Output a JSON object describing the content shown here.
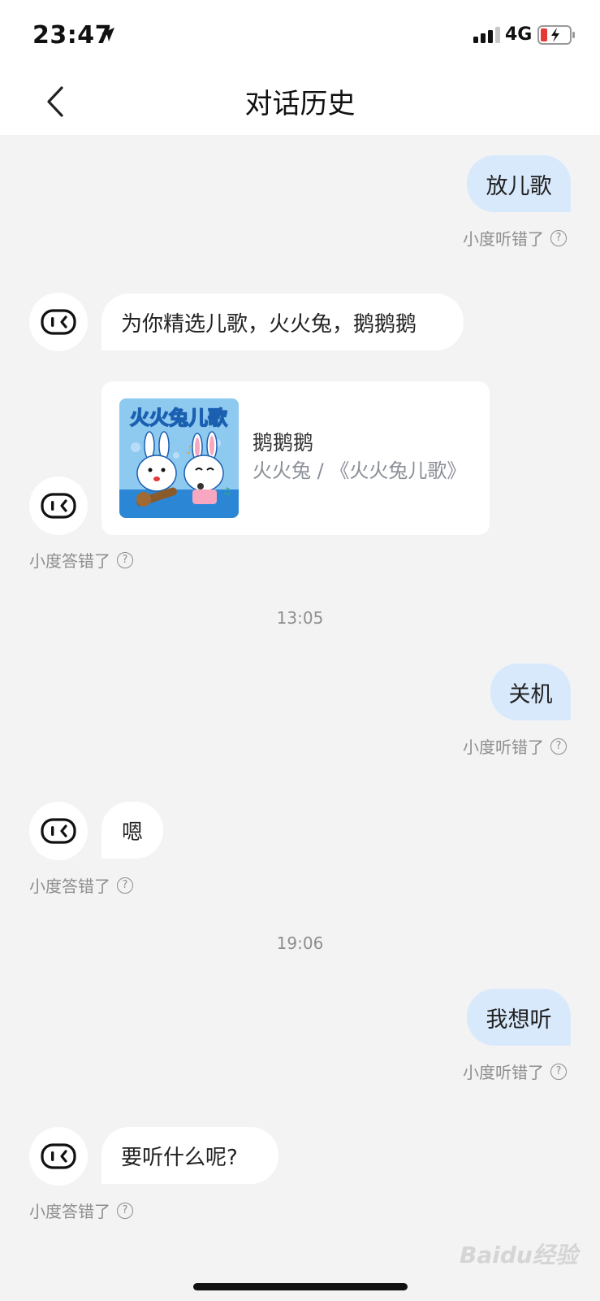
{
  "status_bar": {
    "time": "23:47",
    "network": "4G",
    "icons": [
      "location-arrow-icon",
      "signal-icon",
      "battery-charging-icon"
    ]
  },
  "nav": {
    "title": "对话历史",
    "back_icon": "chevron-left-icon"
  },
  "messages": [
    {
      "role": "user",
      "text": "放儿歌",
      "feedback": "小度听错了"
    },
    {
      "role": "bot",
      "text": "为你精选儿歌，火火兔，鹅鹅鹅"
    },
    {
      "role": "bot_card",
      "song_title": "鹅鹅鹅",
      "song_sub": "火火兔 / 《火火兔儿歌》",
      "cover_text": "火火兔儿歌",
      "feedback": "小度答错了"
    },
    {
      "role": "timestamp",
      "text": "13:05"
    },
    {
      "role": "user",
      "text": "关机",
      "feedback": "小度听错了"
    },
    {
      "role": "bot",
      "text": "嗯",
      "feedback": "小度答错了"
    },
    {
      "role": "timestamp",
      "text": "19:06"
    },
    {
      "role": "user",
      "text": "我想听",
      "feedback": "小度听错了"
    },
    {
      "role": "bot",
      "text": "要听什么呢?",
      "feedback": "小度答错了"
    }
  ],
  "help_glyph": "?",
  "watermark": "Baidu经验",
  "colors": {
    "background": "#f3f3f3",
    "user_bubble": "#d9e9fc",
    "bot_bubble": "#ffffff",
    "muted_text": "#8e8e8e"
  }
}
